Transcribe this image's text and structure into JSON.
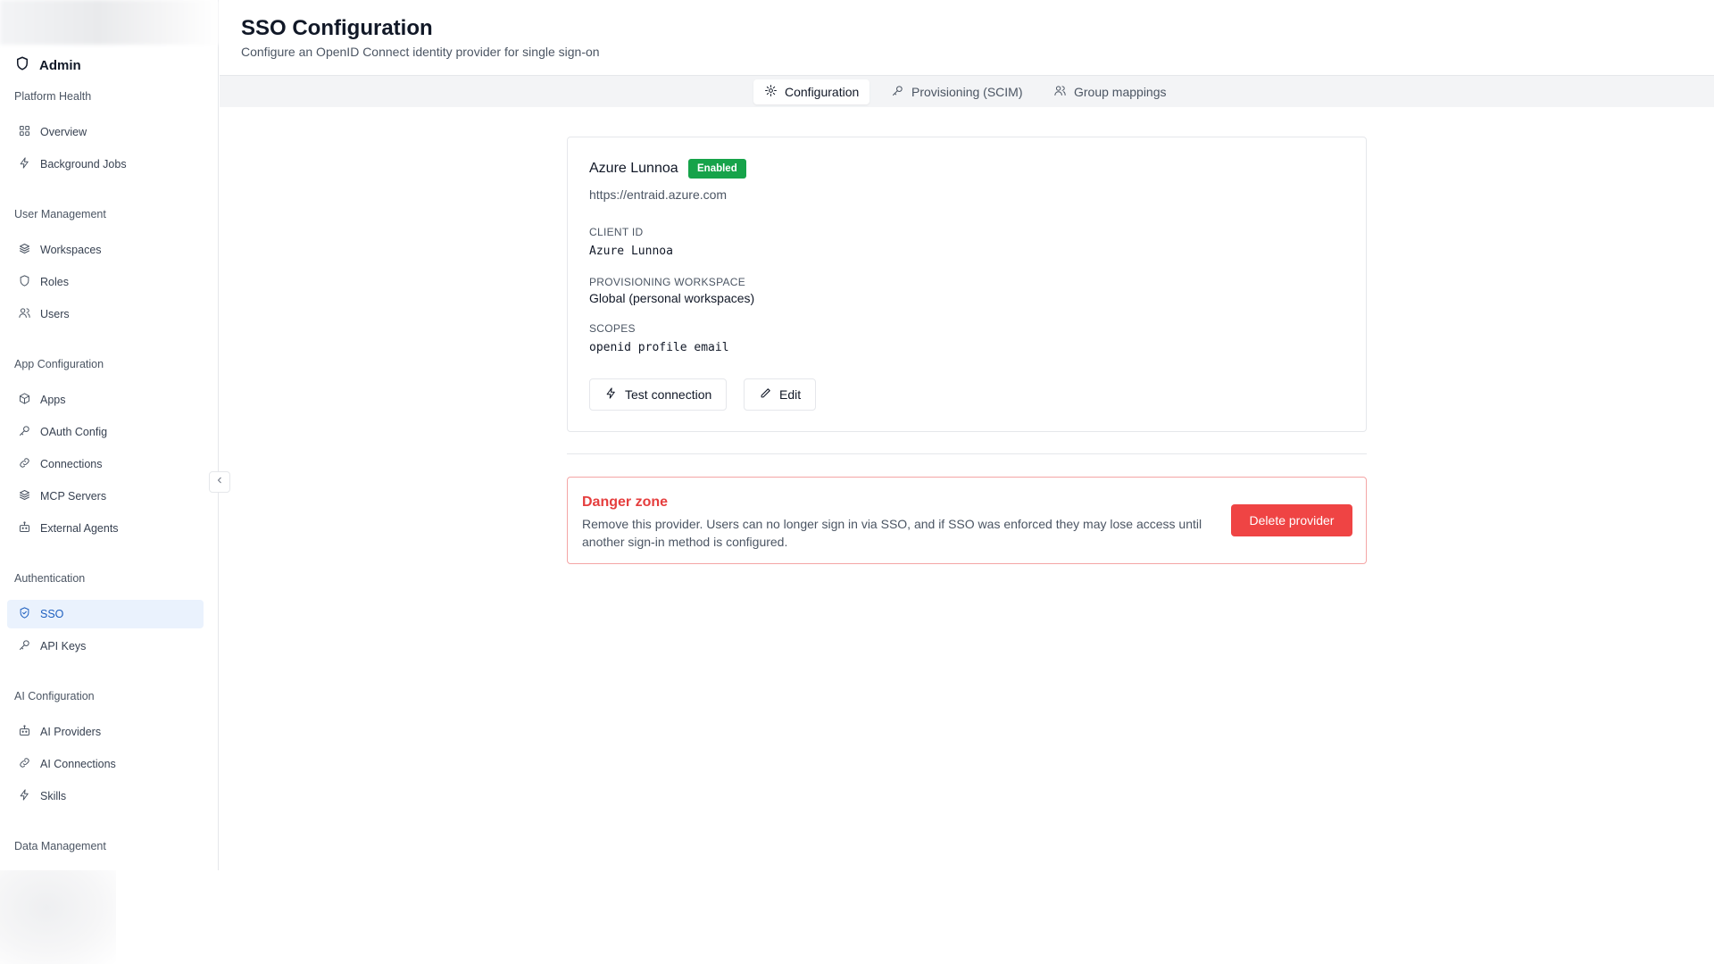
{
  "sidebar": {
    "brand": "Admin",
    "sections": [
      {
        "title": "Platform Health"
      },
      {
        "title": "User Management"
      },
      {
        "title": "App Configuration"
      },
      {
        "title": "Authentication"
      },
      {
        "title": "AI Configuration"
      },
      {
        "title": "Data Management"
      }
    ],
    "items": [
      {
        "label": "Overview",
        "icon": "grid-icon"
      },
      {
        "label": "Background Jobs",
        "icon": "bolt-icon"
      },
      {
        "label": "Workspaces",
        "icon": "layers-icon"
      },
      {
        "label": "Roles",
        "icon": "shield-icon"
      },
      {
        "label": "Users",
        "icon": "users-icon"
      },
      {
        "label": "Apps",
        "icon": "box-icon"
      },
      {
        "label": "OAuth Config",
        "icon": "key-icon"
      },
      {
        "label": "Connections",
        "icon": "link-icon"
      },
      {
        "label": "MCP Servers",
        "icon": "layers-icon"
      },
      {
        "label": "External Agents",
        "icon": "bot-icon"
      },
      {
        "label": "SSO",
        "icon": "shield-check-icon",
        "active": true
      },
      {
        "label": "API Keys",
        "icon": "key-icon"
      },
      {
        "label": "AI Providers",
        "icon": "bot-icon"
      },
      {
        "label": "AI Connections",
        "icon": "link-icon"
      },
      {
        "label": "Skills",
        "icon": "bolt-icon"
      }
    ]
  },
  "header": {
    "title": "SSO Configuration",
    "subtitle": "Configure an OpenID Connect identity provider for single sign-on"
  },
  "tabs": [
    {
      "label": "Configuration",
      "icon": "gear-icon",
      "active": true
    },
    {
      "label": "Provisioning (SCIM)",
      "icon": "key-icon"
    },
    {
      "label": "Group mappings",
      "icon": "users-icon"
    }
  ],
  "provider": {
    "name": "Azure Lunnoa",
    "status": "Enabled",
    "url": "https://entraid.azure.com",
    "client_id_label": "CLIENT ID",
    "client_id": "Azure Lunnoa",
    "workspace_label": "PROVISIONING WORKSPACE",
    "workspace": "Global (personal workspaces)",
    "scopes_label": "SCOPES",
    "scopes": "openid profile email",
    "test_label": "Test connection",
    "edit_label": "Edit"
  },
  "danger": {
    "title": "Danger zone",
    "description": "Remove this provider. Users can no longer sign in via SSO, and if SSO was enforced they may lose access until another sign-in method is configured.",
    "button_label": "Delete provider"
  },
  "colors": {
    "accent": "#1d5fbf",
    "active_bg": "#eaf2fd",
    "success": "#16a34a",
    "danger": "#ef4444"
  }
}
